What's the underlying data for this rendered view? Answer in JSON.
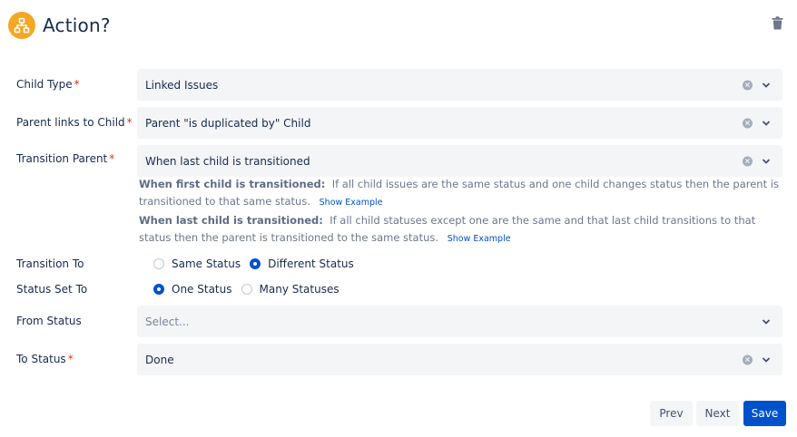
{
  "header": {
    "title": "Action?"
  },
  "fields": {
    "child_type": {
      "label": "Child Type",
      "value": "Linked Issues"
    },
    "parent_links": {
      "label": "Parent links to Child",
      "value": "Parent \"is duplicated by\" Child"
    },
    "transition_parent": {
      "label": "Transition Parent",
      "value": "When last child is transitioned"
    },
    "transition_to": {
      "label": "Transition To",
      "options": [
        "Same Status",
        "Different Status"
      ],
      "selected": "Different Status"
    },
    "status_set_to": {
      "label": "Status Set To",
      "options": [
        "One Status",
        "Many Statuses"
      ],
      "selected": "One Status"
    },
    "from_status": {
      "label": "From Status",
      "placeholder": "Select..."
    },
    "to_status": {
      "label": "To Status",
      "value": "Done"
    }
  },
  "help": {
    "first_title": "When first child is transitioned:",
    "first_text": "If all child issues are the same status and one child changes status then the parent is transitioned to that same status.",
    "last_title": "When last child is transitioned:",
    "last_text": "If all child statuses except one are the same and that last child transitions to that status then the parent is transitioned to the same status.",
    "show_example": "Show Example"
  },
  "required_marker": "*",
  "buttons": {
    "prev": "Prev",
    "next": "Next",
    "save": "Save"
  },
  "colors": {
    "primary": "#0052cc",
    "icon_bg": "#f5a623",
    "required": "#de350b",
    "field_bg": "#f4f5f7"
  },
  "icons": [
    "hierarchy-icon",
    "trash-icon",
    "clear-icon",
    "chevron-down-icon"
  ]
}
